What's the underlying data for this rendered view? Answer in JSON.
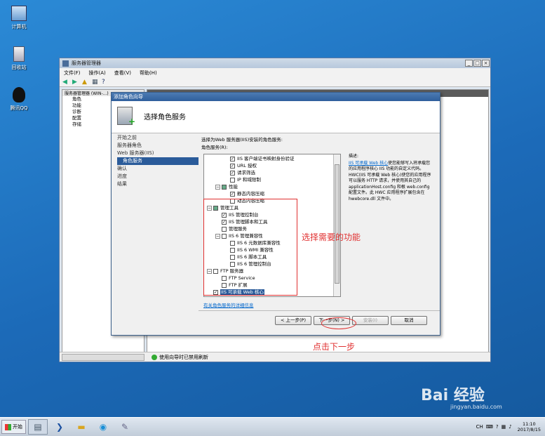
{
  "desktop": {
    "icons": [
      {
        "label": "计算机",
        "icon": "computer-icon"
      },
      {
        "label": "回收站",
        "icon": "recycle-bin-icon"
      },
      {
        "label": "腾讯QQ",
        "icon": "qq-icon"
      }
    ]
  },
  "server_manager": {
    "title": "服务器管理器",
    "menu": [
      "文件(F)",
      "操作(A)",
      "查看(V)",
      "帮助(H)"
    ],
    "tree_header": "服务器管理器 (WIN-...)",
    "tree": [
      "角色",
      "功能",
      "诊断",
      "配置",
      "存储"
    ],
    "status_text": "使用向导时已禁用刷新"
  },
  "wizard": {
    "title": "添加角色向导",
    "header": "选择角色服务",
    "nav": [
      {
        "label": "开始之前",
        "sub": false,
        "active": false
      },
      {
        "label": "服务器角色",
        "sub": false,
        "active": false
      },
      {
        "label": "Web 服务器(IIS)",
        "sub": false,
        "active": false
      },
      {
        "label": "角色服务",
        "sub": true,
        "active": true
      },
      {
        "label": "确认",
        "sub": false,
        "active": false
      },
      {
        "label": "进度",
        "sub": false,
        "active": false
      },
      {
        "label": "结果",
        "sub": false,
        "active": false
      }
    ],
    "desc": "选择为Web 服务器(IIS)安装的角色服务:",
    "list_label": "角色服务(R):",
    "services": [
      {
        "label": "IIS 客户端证书映射身份验证",
        "indent": 3,
        "check": "on",
        "expand": ""
      },
      {
        "label": "URL 授权",
        "indent": 3,
        "check": "on",
        "expand": ""
      },
      {
        "label": "请求筛选",
        "indent": 3,
        "check": "on",
        "expand": ""
      },
      {
        "label": "IP 和域限制",
        "indent": 3,
        "check": "off",
        "expand": ""
      },
      {
        "label": "性能",
        "indent": 2,
        "check": "part",
        "expand": "-"
      },
      {
        "label": "静态内容压缩",
        "indent": 3,
        "check": "on",
        "expand": ""
      },
      {
        "label": "动态内容压缩",
        "indent": 3,
        "check": "off",
        "expand": ""
      },
      {
        "label": "管理工具",
        "indent": 1,
        "check": "part",
        "expand": "-"
      },
      {
        "label": "IIS 管理控制台",
        "indent": 2,
        "check": "on",
        "expand": ""
      },
      {
        "label": "IIS 管理脚本和工具",
        "indent": 2,
        "check": "on",
        "expand": ""
      },
      {
        "label": "管理服务",
        "indent": 2,
        "check": "off",
        "expand": ""
      },
      {
        "label": "IIS 6 管理兼容性",
        "indent": 2,
        "check": "off",
        "expand": "-"
      },
      {
        "label": "IIS 6 元数据库兼容性",
        "indent": 3,
        "check": "off",
        "expand": ""
      },
      {
        "label": "IIS 6 WMI 兼容性",
        "indent": 3,
        "check": "off",
        "expand": ""
      },
      {
        "label": "IIS 6 脚本工具",
        "indent": 3,
        "check": "off",
        "expand": ""
      },
      {
        "label": "IIS 6 管理控制台",
        "indent": 3,
        "check": "off",
        "expand": ""
      },
      {
        "label": "FTP 服务器",
        "indent": 1,
        "check": "off",
        "expand": "-"
      },
      {
        "label": "FTP Service",
        "indent": 2,
        "check": "off",
        "expand": ""
      },
      {
        "label": "FTP 扩展",
        "indent": 2,
        "check": "off",
        "expand": ""
      },
      {
        "label": "IIS 可承载 Web 核心",
        "indent": 1,
        "check": "on",
        "expand": "",
        "selected": true
      }
    ],
    "more_info": "有关角色服务的详细信息",
    "description_title": "描述:",
    "description_link": "IIS 可承载 Web 核心",
    "description_body": "使您能够写入将承载您的应用程序核心 IIS 功能的自定义代码。HWC(IIS 可承载 Web 核心)使您的应用程序可以服务 HTTP 请求，并使用其自己的 applicationHost.config 和根 web.config 配置文件。此 HWC 应用程序扩展包含在 hwebcore.dll 文件中。",
    "buttons": {
      "prev": "< 上一步(P)",
      "next": "下一步(N) >",
      "install": "安装(I)",
      "cancel": "取消"
    }
  },
  "annotations": {
    "select": "选择需要的功能",
    "click_next": "点击下一步"
  },
  "taskbar": {
    "start": "开始",
    "lang": "CH",
    "time": "11:10",
    "date": "2017/8/15"
  },
  "watermark": {
    "brand": "Bai 经验",
    "url": "jingyan.baidu.com"
  }
}
